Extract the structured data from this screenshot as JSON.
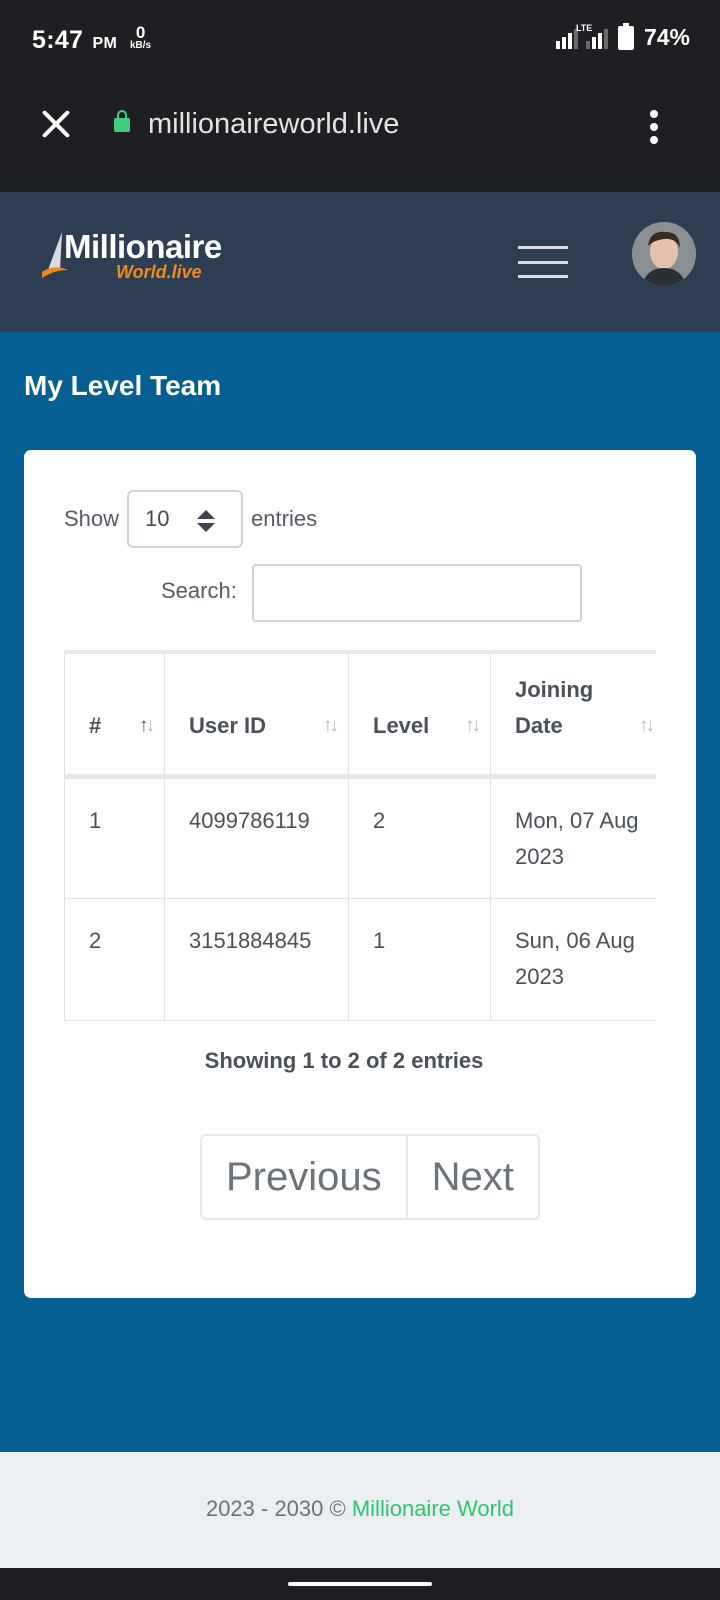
{
  "status_bar": {
    "time": "5:47",
    "ampm": "PM",
    "net_speed": "0",
    "net_unit": "kB/s",
    "network": "LTE",
    "battery": "74%"
  },
  "browser": {
    "url": "millionaireworld.live"
  },
  "header": {
    "logo_main": "Millionaire",
    "logo_sub": "World.live"
  },
  "page": {
    "title": "My Level Team"
  },
  "table_controls": {
    "show_label": "Show",
    "entries_value": "10",
    "entries_label": "entries",
    "search_label": "Search:",
    "search_value": ""
  },
  "table": {
    "columns": [
      {
        "label": "#"
      },
      {
        "label": "User ID"
      },
      {
        "label": "Level"
      },
      {
        "label": "Joining Date"
      }
    ],
    "rows": [
      {
        "num": "1",
        "user_id": "4099786119",
        "level": "2",
        "joining_date": "Mon, 07 Aug 2023"
      },
      {
        "num": "2",
        "user_id": "3151884845",
        "level": "1",
        "joining_date": "Sun, 06 Aug 2023"
      }
    ],
    "info": "Showing 1 to 2 of 2 entries"
  },
  "pagination": {
    "previous": "Previous",
    "next": "Next"
  },
  "footer": {
    "text": "2023 - 2030 ©",
    "brand": "Millionaire World"
  },
  "colors": {
    "page_bg": "#065f93",
    "header_bg": "#2d3e52",
    "brand_green": "#2ec56d",
    "logo_orange": "#f08a1c"
  }
}
